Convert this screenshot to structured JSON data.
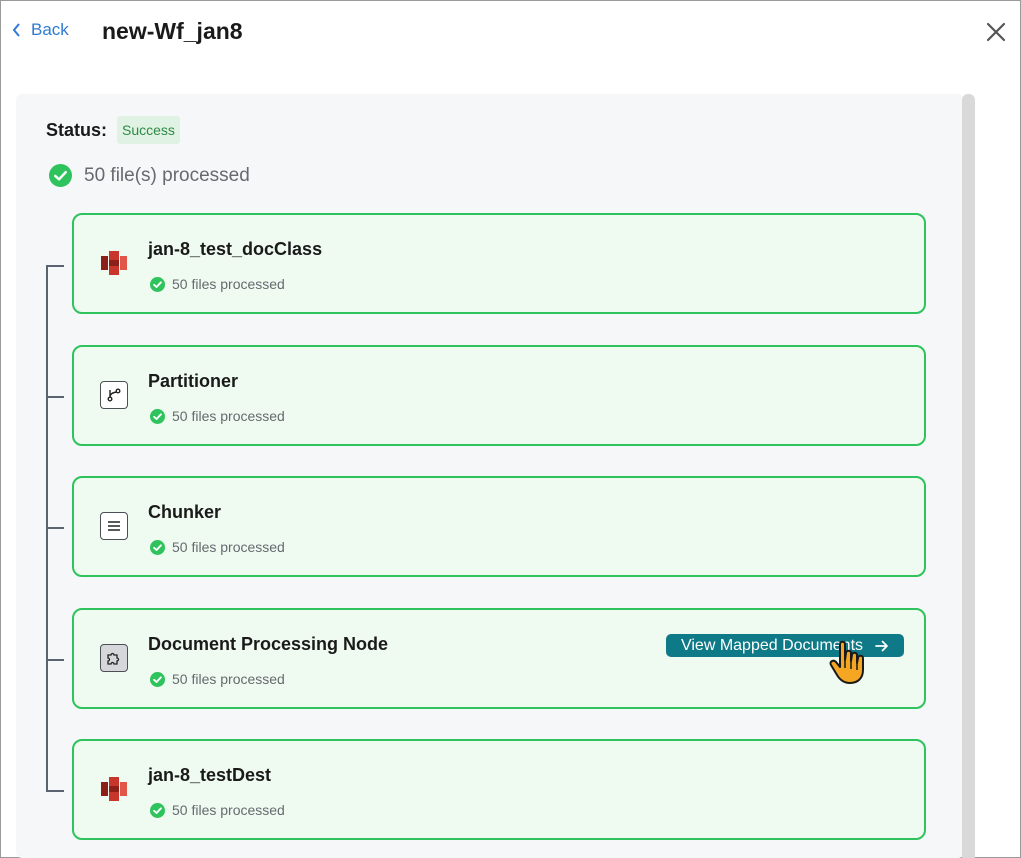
{
  "header": {
    "back_label": "Back",
    "title": "new-Wf_jan8"
  },
  "status": {
    "label": "Status:",
    "value": "Success"
  },
  "summary": {
    "processed_text": "50 file(s) processed"
  },
  "nodes": [
    {
      "name": "jan-8_test_docClass",
      "sub": "50 files processed",
      "icon": "aws-s3-icon"
    },
    {
      "name": "Partitioner",
      "sub": "50 files processed",
      "icon": "branch-icon"
    },
    {
      "name": "Chunker",
      "sub": "50 files processed",
      "icon": "menu-lines-icon"
    },
    {
      "name": "Document Processing Node",
      "sub": "50 files processed",
      "icon": "puzzle-icon",
      "action_label": "View Mapped Documents"
    },
    {
      "name": "jan-8_testDest",
      "sub": "50 files processed",
      "icon": "aws-s3-icon"
    }
  ],
  "colors": {
    "success_green": "#2ec35c",
    "accent_teal": "#0f7a87",
    "link_blue": "#2f7ad3",
    "s3_red": "#c7352b"
  }
}
